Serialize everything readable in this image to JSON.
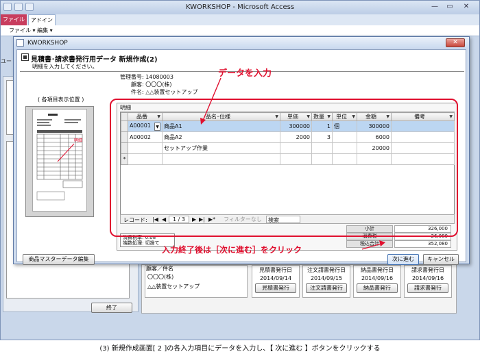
{
  "window": {
    "title": "KWORKSHOP - Microsoft Access",
    "minimize_icon": "minimize-icon",
    "maximize_icon": "maximize-icon",
    "close_icon": "close-icon",
    "min_glyph": "—",
    "max_glyph": "▭",
    "close_glyph": "✕"
  },
  "ribbon": {
    "tabs": [
      "ファイル",
      "アドイン"
    ],
    "menu": "ファイル ▾  編集 ▾"
  },
  "nav_label": "ユー",
  "background_form": {
    "customer_header": "顧客／件名",
    "customer_name": "〇〇〇(株)",
    "customer_subject": "△△装置セットアップ",
    "documents": [
      {
        "header": "見積書発行日",
        "date": "2014/09/14",
        "button": "見積書発行"
      },
      {
        "header": "注文請書発行日",
        "date": "2014/09/15",
        "button": "注文請書発行"
      },
      {
        "header": "納品書発行日",
        "date": "2014/09/16",
        "button": "納品書発行"
      },
      {
        "header": "請求書発行日",
        "date": "2014/09/16",
        "button": "請求書発行"
      }
    ],
    "exit_button": "終了"
  },
  "dialog": {
    "title": "KWORKSHOP",
    "close_glyph": "✕",
    "form_title": "見積書･請求書発行用データ 新規作成(2)",
    "form_subtitle": "明細を入力してください。",
    "preview_label": "( 各項目表示位置 )",
    "preview_badge": "明細",
    "info": {
      "mgmt_label": "管理番号:",
      "mgmt_value": "14080003",
      "customer_label": "顧客:",
      "customer_value": "〇〇〇(株)",
      "subject_label": "件名:",
      "subject_value": "△△装置セットアップ"
    },
    "detail_label": "明細",
    "grid": {
      "columns": [
        "品番",
        "品名･仕様",
        "単価",
        "数量",
        "単位",
        "金額",
        "備考"
      ],
      "rows": [
        {
          "code": "A00001",
          "name": "商品A1",
          "price": "300000",
          "qty": "1",
          "unit": "個",
          "amount": "300000",
          "note": ""
        },
        {
          "code": "A00002",
          "name": "商品A2",
          "price": "2000",
          "qty": "3",
          "unit": "",
          "amount": "6000",
          "note": ""
        },
        {
          "code": "",
          "name": "セットアップ作業",
          "price": "",
          "qty": "",
          "unit": "",
          "amount": "20000",
          "note": ""
        }
      ],
      "new_row_marker": "*"
    },
    "nav": {
      "record_label": "レコード:",
      "first": "|◀",
      "prev": "◀",
      "position": "1 / 3",
      "next": "▶",
      "last": "▶|",
      "new": "▶*",
      "filter": "フィルターなし",
      "search": "検索"
    },
    "tax": {
      "rate": "消費税率: 0.08",
      "rounding": "端数処理: 切捨て"
    },
    "totals": [
      {
        "label": "小計",
        "value": "326,000"
      },
      {
        "label": "消費税",
        "value": "26,080"
      },
      {
        "label": "税込合計",
        "value": "352,080"
      }
    ],
    "buttons": {
      "master": "商品マスターデータ編集",
      "next": "次に進む",
      "cancel": "キャンセル"
    }
  },
  "annotations": {
    "data_entry": "データを入力",
    "finish": "入力終了後は［次に進む］をクリック"
  },
  "caption": "(3) 新規作成画面[ 2 ]の各入力項目にデータを入力し、【 次に進む 】ボタンをクリックする"
}
